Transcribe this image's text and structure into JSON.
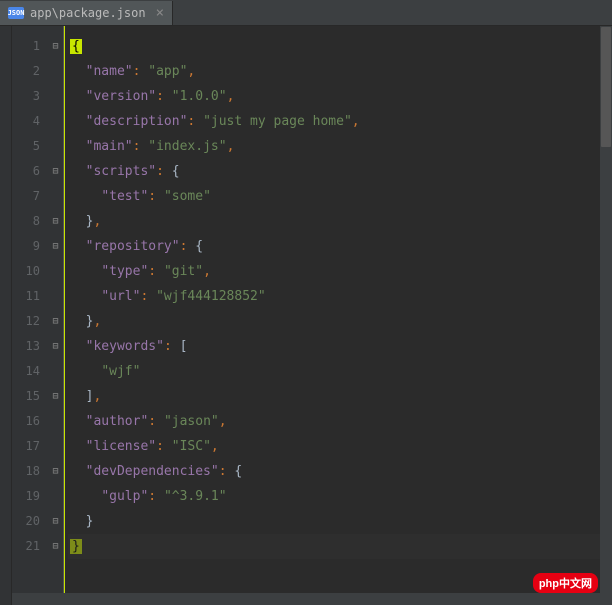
{
  "tab": {
    "icon_label": "JSON",
    "title": "app\\package.json",
    "close": "×"
  },
  "lines": [
    "1",
    "2",
    "3",
    "4",
    "5",
    "6",
    "7",
    "8",
    "9",
    "10",
    "11",
    "12",
    "13",
    "14",
    "15",
    "16",
    "17",
    "18",
    "19",
    "20",
    "21"
  ],
  "folds": {
    "l1": "⊟",
    "l6": "⊟",
    "l8": "⊟",
    "l9": "⊟",
    "l12": "⊟",
    "l13": "⊟",
    "l15": "⊟",
    "l18": "⊟",
    "l20": "⊟",
    "l21": "⊟"
  },
  "code": {
    "l1": {
      "open": "{"
    },
    "l2": {
      "k": "\"name\"",
      "c": ": ",
      "v": "\"app\"",
      "e": ","
    },
    "l3": {
      "k": "\"version\"",
      "c": ": ",
      "v": "\"1.0.0\"",
      "e": ","
    },
    "l4": {
      "k": "\"description\"",
      "c": ": ",
      "v": "\"just my page home\"",
      "e": ","
    },
    "l5": {
      "k": "\"main\"",
      "c": ": ",
      "v": "\"index.js\"",
      "e": ","
    },
    "l6": {
      "k": "\"scripts\"",
      "c": ": ",
      "b": "{"
    },
    "l7": {
      "k": "\"test\"",
      "c": ": ",
      "v": "\"some\""
    },
    "l8": {
      "b": "}",
      "e": ","
    },
    "l9": {
      "k": "\"repository\"",
      "c": ": ",
      "b": "{"
    },
    "l10": {
      "k": "\"type\"",
      "c": ": ",
      "v": "\"git\"",
      "e": ","
    },
    "l11": {
      "k": "\"url\"",
      "c": ": ",
      "v": "\"wjf444128852\""
    },
    "l12": {
      "b": "}",
      "e": ","
    },
    "l13": {
      "k": "\"keywords\"",
      "c": ": ",
      "b": "["
    },
    "l14": {
      "v": "\"wjf\""
    },
    "l15": {
      "b": "]",
      "e": ","
    },
    "l16": {
      "k": "\"author\"",
      "c": ": ",
      "v": "\"jason\"",
      "e": ","
    },
    "l17": {
      "k": "\"license\"",
      "c": ": ",
      "v": "\"ISC\"",
      "e": ","
    },
    "l18": {
      "k": "\"devDependencies\"",
      "c": ": ",
      "b": "{"
    },
    "l19": {
      "k": "\"gulp\"",
      "c": ": ",
      "v": "\"^3.9.1\""
    },
    "l20": {
      "b": "}"
    },
    "l21": {
      "close": "}"
    }
  },
  "watermark": {
    "text": "php中文网"
  }
}
